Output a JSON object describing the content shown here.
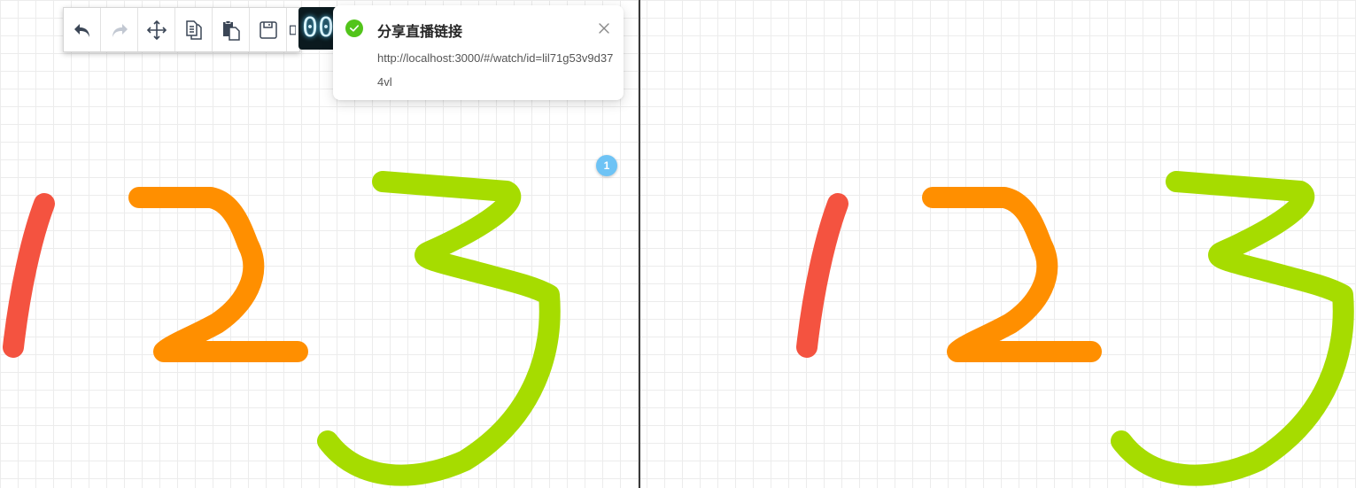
{
  "notification": {
    "title": "分享直播链接",
    "message": "http://localhost:3000/#/watch/id=lil71g53v9d374vl",
    "status_color": "#52c41a"
  },
  "timer": {
    "display": "00"
  },
  "participant_badge": {
    "count": "1",
    "color": "#6ec3f5"
  },
  "toolbar": {
    "tools": [
      {
        "name": "undo",
        "icon": "undo-icon",
        "enabled": true
      },
      {
        "name": "redo",
        "icon": "redo-icon",
        "enabled": false
      },
      {
        "name": "move",
        "icon": "move-icon",
        "enabled": true
      },
      {
        "name": "copy",
        "icon": "copy-icon",
        "enabled": true
      },
      {
        "name": "paste",
        "icon": "paste-icon",
        "enabled": true
      },
      {
        "name": "save",
        "icon": "save-icon",
        "enabled": true
      }
    ]
  },
  "drawing": {
    "strokes": [
      {
        "id": "stroke-1",
        "color": "#f45340"
      },
      {
        "id": "stroke-2",
        "color": "#ff8f00"
      },
      {
        "id": "stroke-3",
        "color": "#a6dc00"
      }
    ]
  }
}
